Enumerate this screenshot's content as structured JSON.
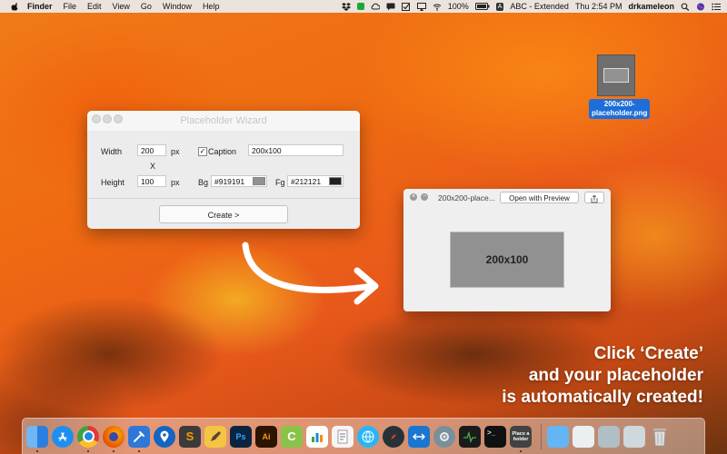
{
  "menubar": {
    "app": "Finder",
    "menus": [
      "File",
      "Edit",
      "View",
      "Go",
      "Window",
      "Help"
    ],
    "status": {
      "battery": "100%",
      "input_source": "ABC - Extended",
      "input_letter": "A",
      "clock": "Thu 2:54 PM",
      "user": "drkameleon"
    }
  },
  "desktop_file": {
    "name": "200x200-placeholder.png",
    "name_line1": "200x200-",
    "name_line2": "placeholder.png"
  },
  "wizard": {
    "title": "Placeholder Wizard",
    "width_label": "Width",
    "width_value": "200",
    "height_label": "Height",
    "height_value": "100",
    "unit": "px",
    "times": "X",
    "caption_checked": true,
    "caption_check_glyph": "✓",
    "caption_label": "Caption",
    "caption_value": "200x100",
    "bg_label": "Bg",
    "bg_value": "#919191",
    "fg_label": "Fg",
    "fg_value": "#212121",
    "create_label": "Create >"
  },
  "preview": {
    "filename": "200x200-place...",
    "open_with_label": "Open with Preview",
    "image_caption": "200x100",
    "close_glyph": "×",
    "min_glyph": "−"
  },
  "promo": {
    "line1": "Click ‘Create’",
    "line2": "and your placeholder",
    "line3": "is automatically created!"
  },
  "dock": {
    "items": [
      {
        "name": "finder",
        "running": true
      },
      {
        "name": "app-store",
        "running": false
      },
      {
        "name": "chrome",
        "running": true
      },
      {
        "name": "firefox",
        "running": true
      },
      {
        "name": "xcode-tools",
        "running": true
      },
      {
        "name": "maps-pin",
        "running": false
      },
      {
        "name": "sublime-text",
        "running": false
      },
      {
        "name": "sketch-book",
        "running": false
      },
      {
        "name": "photoshop",
        "running": false,
        "label": "Ps"
      },
      {
        "name": "illustrator",
        "running": false,
        "label": "Ai"
      },
      {
        "name": "c-app",
        "running": false,
        "label": "C"
      },
      {
        "name": "numbers",
        "running": false
      },
      {
        "name": "textedit",
        "running": false
      },
      {
        "name": "browser-globe",
        "running": false
      },
      {
        "name": "safari-compass",
        "running": false
      },
      {
        "name": "teamviewer",
        "running": false
      },
      {
        "name": "system-preferences",
        "running": false
      },
      {
        "name": "activity-monitor",
        "running": false
      },
      {
        "name": "terminal",
        "running": false,
        "label": ">_"
      },
      {
        "name": "placeholder-app",
        "running": true,
        "label": "Place a holder"
      }
    ],
    "right_items": [
      {
        "name": "applications-folder"
      },
      {
        "name": "documents-stack"
      },
      {
        "name": "downloads-stack"
      },
      {
        "name": "desktop-stack"
      },
      {
        "name": "trash"
      }
    ]
  },
  "colors": {
    "placeholder_bg": "#919191",
    "placeholder_fg": "#212121",
    "selection_blue": "#1d6ed8"
  }
}
